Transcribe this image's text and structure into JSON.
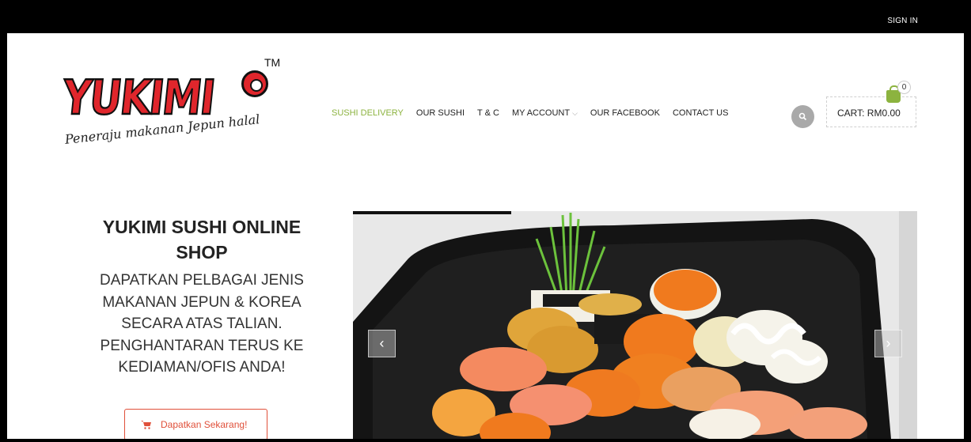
{
  "topbar": {
    "signin_label": "SIGN IN"
  },
  "logo": {
    "wordmark": "YUKIMI",
    "trademark": "TM",
    "tagline": "Peneraju makanan Jepun halal"
  },
  "nav": {
    "items": [
      {
        "label": "SUSHI DELIVERY",
        "active": true
      },
      {
        "label": "OUR SUSHI"
      },
      {
        "label": "T & C"
      },
      {
        "label": "MY ACCOUNT",
        "has_dropdown": true
      },
      {
        "label": "OUR FACEBOOK"
      },
      {
        "label": "CONTACT US"
      }
    ]
  },
  "header": {
    "search_icon": "search-icon",
    "cart_label": "CART: RM0.00",
    "cart_count": "0",
    "cart_icon": "shopping-bag-icon"
  },
  "promo": {
    "title": "YUKIMI SUSHI ONLINE SHOP",
    "body": "DAPATKAN PELBAGAI JENIS MAKANAN JEPUN & KOREA SECARA ATAS TALIAN. PENGHANTARAN TERUS KE KEDIAMAN/OFIS ANDA!",
    "cta_label": "Dapatkan Sekarang!",
    "cta_icon": "cart-icon"
  },
  "slider": {
    "prev_icon": "chevron-left-icon",
    "next_icon": "chevron-right-icon",
    "prev_glyph": "‹",
    "next_glyph": "›",
    "image": "sushi-platter-photo",
    "progress": 0.28
  },
  "colors": {
    "accent_green": "#8cb33f",
    "brand_red": "#e0262c",
    "cta_orange": "#e0503a"
  }
}
